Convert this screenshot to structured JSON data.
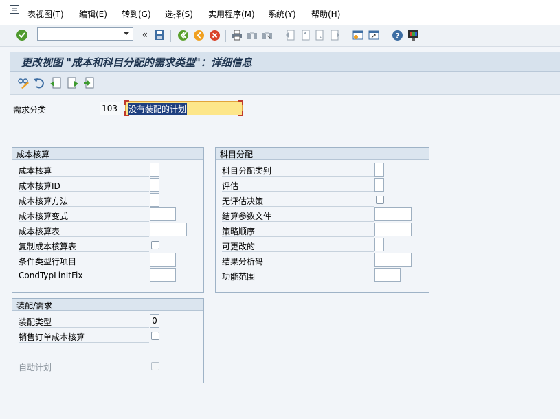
{
  "menu": {
    "items": [
      "表视图(T)",
      "编辑(E)",
      "转到(G)",
      "选择(S)",
      "实用程序(M)",
      "系统(Y)",
      "帮助(H)"
    ]
  },
  "toolbar": {
    "command_value": "",
    "icons": [
      "enter-icon",
      "save-icon",
      "back-icon",
      "exit-icon",
      "cancel-icon",
      "print-icon",
      "find-icon",
      "find-next-icon",
      "first-page-icon",
      "previous-page-icon",
      "next-page-icon",
      "last-page-icon",
      "create-session-icon",
      "shortcut-icon",
      "help-icon",
      "customize-layout-icon"
    ]
  },
  "title": "更改视图 \"成本和科目分配的需求类型\"：详细信息",
  "header": {
    "req_class_label": "需求分类",
    "req_class_value": "103",
    "req_class_text": "没有装配的计划"
  },
  "costing": {
    "title": "成本核算",
    "rows": [
      "成本核算",
      "成本核算ID",
      "成本核算方法",
      "成本核算变式",
      "成本核算表",
      "复制成本核算表",
      "条件类型行项目",
      "CondTypLinItFix"
    ]
  },
  "account": {
    "title": "科目分配",
    "rows": [
      "科目分配类别",
      "评估",
      "无评估决策",
      "结算参数文件",
      "策略顺序",
      "可更改的",
      "结果分析码",
      "功能范围"
    ]
  },
  "assembly": {
    "title": "装配/需求",
    "rows": [
      "装配类型",
      "销售订单成本核算",
      "自动计划"
    ],
    "assembly_type_value": "0"
  },
  "colors": {
    "title_bar": "#d7e2ed",
    "highlight_field": "#fde68a",
    "selected_text": "#1f3f7f"
  }
}
